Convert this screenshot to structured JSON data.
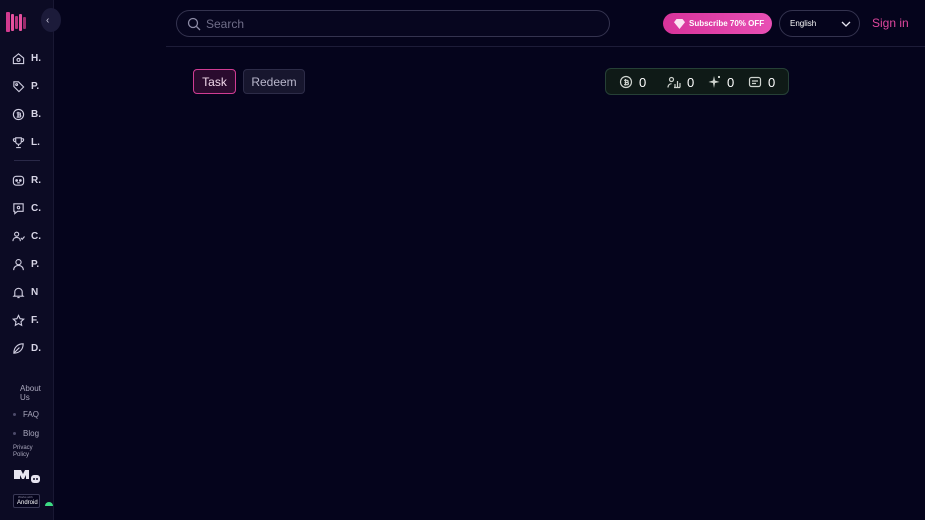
{
  "sidebar": {
    "collapse_glyph": "‹",
    "items": [
      {
        "label": "H.",
        "icon": "home-icon"
      },
      {
        "label": "P.",
        "icon": "tag-icon"
      },
      {
        "label": "B.",
        "icon": "coin-icon"
      },
      {
        "label": "L.",
        "icon": "trophy-icon"
      },
      {
        "label": "R.",
        "icon": "robot-icon"
      },
      {
        "label": "C.",
        "icon": "chat-icon"
      },
      {
        "label": "C.",
        "icon": "community-icon"
      },
      {
        "label": "P.",
        "icon": "user-icon"
      },
      {
        "label": "N",
        "icon": "bell-icon"
      },
      {
        "label": "F.",
        "icon": "star-icon"
      },
      {
        "label": "D.",
        "icon": "leaf-icon"
      }
    ],
    "footer": {
      "about_line1": "About",
      "about_line2": "Us",
      "faq": "FAQ",
      "blog": "Blog",
      "privacy_line1": "Privacy",
      "privacy_line2": "Policy",
      "android_small": "Works with",
      "android": "Android"
    }
  },
  "header": {
    "search_placeholder": "Search",
    "subscribe_label": "Subscribe 70% OFF",
    "language": "English",
    "sign_in": "Sign in"
  },
  "tabs": {
    "task": "Task",
    "redeem": "Redeem"
  },
  "stats": [
    {
      "icon": "coins-icon",
      "value": "0"
    },
    {
      "icon": "chart-icon",
      "value": "0"
    },
    {
      "icon": "sparkle-icon",
      "value": "0"
    },
    {
      "icon": "message-icon",
      "value": "0"
    }
  ],
  "colors": {
    "background": "#05041c",
    "accent_pink": "#e0479e",
    "stats_bg": "#0f1a17"
  }
}
